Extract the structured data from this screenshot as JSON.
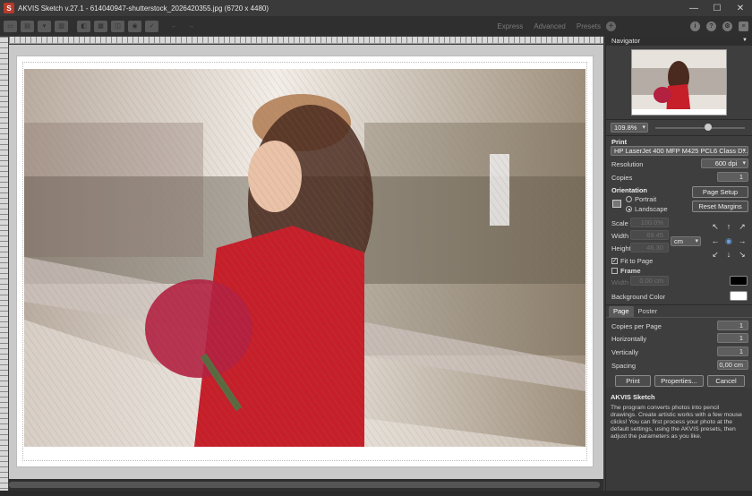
{
  "window": {
    "title": "AKVIS Sketch v.27.1 - 614040947-shutterstock_2026420355.jpg (6720 x 4480)",
    "app_icon_letter": "S",
    "controls": [
      "—",
      "☐",
      "✕"
    ]
  },
  "toolbar": {
    "tabs": [
      "Express",
      "Advanced",
      "Presets"
    ],
    "add_glyph": "+"
  },
  "navigator": {
    "title": "Navigator",
    "zoom": "109.8%",
    "zoom_slider_fraction": 0.6
  },
  "print": {
    "section": "Print",
    "printer": "HP LaserJet 400 MFP M425 PCL6 Class D...",
    "resolution_label": "Resolution",
    "resolution_value": "600 dpi",
    "copies_label": "Copies",
    "copies_value": "1",
    "orientation_label": "Orientation",
    "portrait_label": "Portrait",
    "landscape_label": "Landscape",
    "page_setup": "Page Setup",
    "reset_margins": "Reset Margins",
    "scale_label": "Scale",
    "scale_value": "100.0%",
    "width_label": "Width",
    "width_value": "69.45",
    "height_label": "Height",
    "height_value": "46.30",
    "unit": "cm",
    "fit_to_page": "Fit to Page",
    "frame_label": "Frame",
    "frame_width_label": "Width",
    "frame_width_value": "0.00 cm",
    "frame_color": "#000000",
    "background_color_label": "Background Color",
    "background_color": "#ffffff"
  },
  "page_tabs": {
    "page": "Page",
    "poster": "Poster",
    "copies_per_page_label": "Copies per Page",
    "copies_per_page": "1",
    "horizontally_label": "Horizontally",
    "horizontally": "1",
    "vertically_label": "Vertically",
    "vertically": "1",
    "spacing_label": "Spacing",
    "spacing": "0,00 cm"
  },
  "buttons": {
    "print": "Print",
    "properties": "Properties...",
    "cancel": "Cancel"
  },
  "help": {
    "title": "AKVIS Sketch",
    "body": "The program converts photos into pencil drawings. Create artistic works with a few mouse clicks! You can first process your photo at the default settings, using the AKVIS presets, then adjust the parameters as you like."
  },
  "icons": [
    "new-icon",
    "open-icon",
    "save-icon",
    "print-icon",
    "share-icon",
    "batch-icon",
    "before-after-icon",
    "zoom-icon",
    "undo-icon",
    "redo-icon",
    "info-icon",
    "help-icon",
    "settings-icon",
    "preferences-icon"
  ],
  "colors": {
    "accent": "#c0392b",
    "panel": "#3e3e3e",
    "toolbar": "#2f2f2f"
  }
}
